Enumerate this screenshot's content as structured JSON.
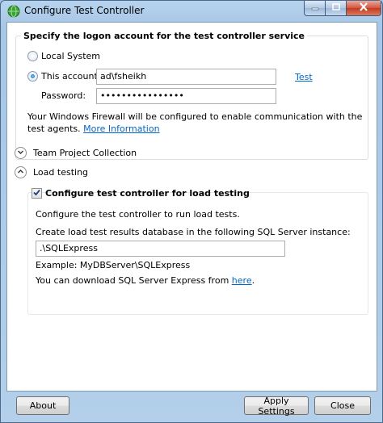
{
  "window": {
    "title": "Configure Test Controller"
  },
  "logon": {
    "group_title": "Specify the logon account for the test controller service",
    "local_system_label": "Local System",
    "this_account_label": "This account:",
    "account_value": "ad\\fsheikh",
    "test_link": "Test",
    "password_label": "Password:",
    "password_value": "••••••••••••••••",
    "firewall_text": "Your Windows Firewall will be configured to enable communication with the",
    "firewall_text_2": "test agents.",
    "more_info_link": "More Information",
    "selected_option": "This account"
  },
  "team_project": {
    "label": "Team Project Collection",
    "expanded": false
  },
  "load_testing": {
    "label": "Load testing",
    "expanded": true,
    "checkbox_label": "Configure test controller for load testing",
    "checked": true,
    "description": "Configure the test controller to run load tests.",
    "db_label": "Create load test results database in the following SQL Server instance:",
    "instance_value": ".\\SQLExpress",
    "example_text": "Example: MyDBServer\\SQLExpress",
    "download_text": "You can download SQL Server Express from",
    "here_link": "here",
    "download_suffix": "."
  },
  "buttons": {
    "about": "About",
    "apply": "Apply Settings",
    "close": "Close"
  },
  "icons": {
    "app": "green-globe-icon",
    "minimize": "minimize-icon",
    "maximize": "maximize-icon",
    "close": "close-icon",
    "collapsed": "chevron-down-icon",
    "expanded": "chevron-up-icon",
    "check": "checkmark-icon"
  },
  "colors": {
    "link": "#0066cc",
    "title_bar": "#a8c7e6",
    "close_button": "#c43a20"
  }
}
